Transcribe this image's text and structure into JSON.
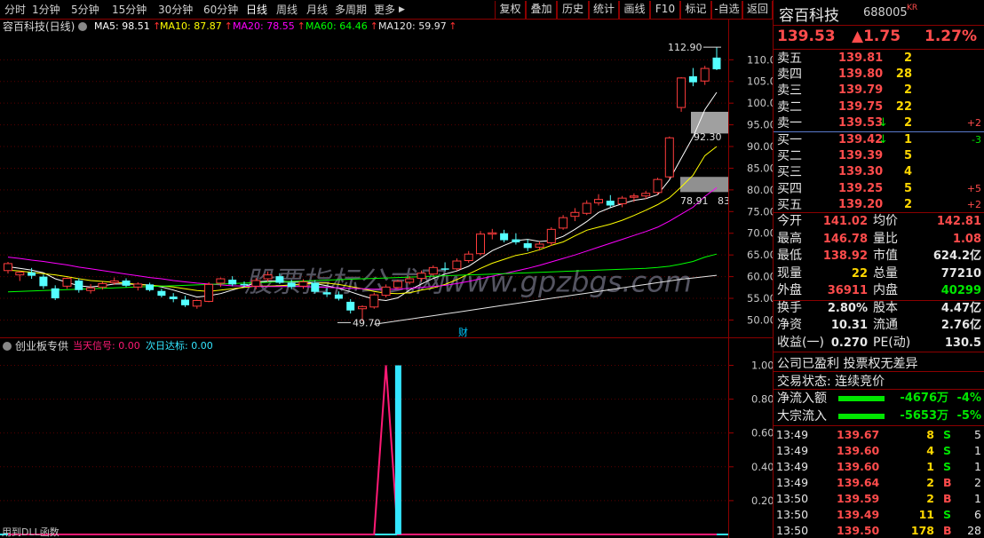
{
  "toolbar": {
    "periods": [
      "分时",
      "1分钟",
      "5分钟",
      "15分钟",
      "30分钟",
      "60分钟",
      "日线",
      "周线",
      "月线",
      "多周期",
      "更多"
    ],
    "active": "日线",
    "more_arrow": "▶",
    "buttons": [
      "复权",
      "叠加",
      "历史",
      "统计",
      "画线",
      "F10",
      "标记",
      "-自选",
      "返回"
    ]
  },
  "chart_title": "容百科技(日线)",
  "ma": [
    {
      "label": "MA5: 98.51",
      "color": "#ffffff"
    },
    {
      "label": "MA10: 87.87",
      "color": "#ffff00"
    },
    {
      "label": "MA20: 78.55",
      "color": "#ff00ff"
    },
    {
      "label": "MA60: 64.46",
      "color": "#00ff00"
    },
    {
      "label": "MA120: 59.97",
      "color": "#e6e6e6"
    }
  ],
  "ma_arrow": "↑",
  "indicator": {
    "name": "创业板专供",
    "signal_label": "当天信号: 0.00",
    "target_label": "次日达标: 0.00"
  },
  "watermark": "股票指标公式网www.gpzbgs.com",
  "fin_marker": "财",
  "bottom_note": "用到DLL函数",
  "chart_data": [
    {
      "type": "candlestick",
      "title": "容百科技(日线)",
      "ylim": [
        46,
        116
      ],
      "yticks": [
        "110.0",
        "105.0",
        "100.0",
        "95.00",
        "90.00",
        "85.00",
        "80.00",
        "75.00",
        "70.00",
        "65.00",
        "60.00",
        "55.00",
        "50.00"
      ],
      "annotations": {
        "high": "112.90",
        "mid": "92.30",
        "low": "49.70",
        "pre": "78.91",
        "pre_suffix": "83"
      },
      "candles": [
        [
          61.4,
          63.4,
          60.7,
          63.0
        ],
        [
          60.4,
          61.3,
          59.0,
          61.0
        ],
        [
          61.0,
          62.0,
          59.5,
          60.2
        ],
        [
          60.0,
          60.5,
          57.2,
          57.8
        ],
        [
          57.3,
          58.0,
          54.6,
          55.0
        ],
        [
          57.8,
          59.8,
          57.2,
          59.6
        ],
        [
          59.1,
          59.6,
          56.3,
          56.9
        ],
        [
          56.8,
          58.3,
          56.1,
          57.4
        ],
        [
          57.6,
          58.8,
          57.0,
          58.4
        ],
        [
          58.6,
          59.8,
          58.1,
          59.0
        ],
        [
          59.1,
          59.6,
          57.6,
          57.9
        ],
        [
          57.6,
          58.7,
          56.8,
          58.3
        ],
        [
          58.2,
          58.6,
          56.6,
          56.9
        ],
        [
          56.7,
          57.2,
          55.2,
          55.6
        ],
        [
          55.4,
          56.2,
          54.1,
          54.8
        ],
        [
          54.7,
          55.6,
          53.0,
          53.4
        ],
        [
          53.2,
          54.7,
          52.6,
          54.5
        ],
        [
          54.3,
          58.7,
          54.1,
          58.2
        ],
        [
          58.5,
          59.8,
          57.6,
          59.5
        ],
        [
          59.3,
          60.1,
          57.8,
          58.2
        ],
        [
          58.3,
          58.9,
          57.5,
          58.0
        ],
        [
          57.8,
          59.7,
          57.1,
          59.1
        ],
        [
          59.5,
          61.2,
          58.9,
          60.4
        ],
        [
          60.1,
          60.8,
          58.3,
          58.6
        ],
        [
          58.6,
          59.3,
          57.1,
          57.6
        ],
        [
          57.8,
          59.4,
          57.2,
          58.8
        ],
        [
          58.6,
          59.2,
          56.1,
          56.5
        ],
        [
          56.4,
          57.3,
          55.3,
          55.9
        ],
        [
          55.9,
          56.6,
          54.5,
          54.9
        ],
        [
          54.2,
          54.8,
          51.5,
          52.2
        ],
        [
          52.6,
          53.4,
          49.7,
          53.1
        ],
        [
          53.0,
          56.3,
          52.6,
          55.8
        ],
        [
          55.7,
          58.2,
          55.2,
          57.6
        ],
        [
          57.5,
          59.3,
          57.1,
          58.9
        ],
        [
          58.7,
          60.1,
          58.2,
          59.5
        ],
        [
          59.6,
          61.4,
          58.9,
          60.8
        ],
        [
          60.6,
          62.6,
          60.2,
          62.1
        ],
        [
          61.9,
          63.3,
          61.3,
          61.6
        ],
        [
          61.8,
          64.2,
          61.4,
          63.6
        ],
        [
          63.7,
          65.9,
          63.2,
          65.2
        ],
        [
          65.3,
          70.5,
          64.9,
          69.8
        ],
        [
          69.8,
          71.0,
          68.6,
          70.1
        ],
        [
          70.0,
          70.8,
          67.9,
          68.4
        ],
        [
          68.6,
          70.0,
          67.4,
          67.9
        ],
        [
          67.7,
          68.6,
          65.9,
          66.6
        ],
        [
          66.8,
          68.1,
          66.0,
          67.5
        ],
        [
          67.8,
          71.4,
          67.1,
          70.9
        ],
        [
          71.2,
          74.2,
          70.8,
          73.6
        ],
        [
          73.9,
          75.8,
          72.8,
          74.8
        ],
        [
          74.6,
          77.6,
          74.2,
          76.9
        ],
        [
          77.0,
          79.0,
          76.4,
          77.8
        ],
        [
          77.5,
          78.8,
          76.0,
          76.4
        ],
        [
          76.8,
          78.6,
          76.0,
          78.1
        ],
        [
          78.3,
          79.2,
          77.2,
          78.6
        ],
        [
          78.6,
          79.8,
          77.9,
          79.2
        ],
        [
          79.4,
          82.8,
          78.9,
          82.4
        ],
        [
          83.0,
          92.3,
          82.6,
          92.0
        ],
        [
          99.0,
          106.0,
          98.0,
          105.8
        ],
        [
          106.2,
          108.1,
          103.9,
          104.8
        ],
        [
          105.1,
          108.6,
          104.2,
          108.0
        ],
        [
          110.5,
          112.9,
          107.6,
          107.8
        ]
      ],
      "series": [
        {
          "name": "MA5",
          "color": "#ffffff",
          "values": [
            62.3,
            61.9,
            61.5,
            60.9,
            59.5,
            58.7,
            57.9,
            57.6,
            57.9,
            58.3,
            58.3,
            58.2,
            58.1,
            57.6,
            56.9,
            56.1,
            55.3,
            55.6,
            56.1,
            56.9,
            57.7,
            58.6,
            59.0,
            59.0,
            58.8,
            58.9,
            58.4,
            57.9,
            57.3,
            56.5,
            55.6,
            54.8,
            54.5,
            55.1,
            56.9,
            58.3,
            59.6,
            60.6,
            61.3,
            62.4,
            64.2,
            66.0,
            67.2,
            68.3,
            68.6,
            68.1,
            68.3,
            69.3,
            70.9,
            72.7,
            74.8,
            75.9,
            76.8,
            77.6,
            78.0,
            78.9,
            82.3,
            87.3,
            92.2,
            98.5,
            102.5
          ]
        },
        {
          "name": "MA10",
          "color": "#ffff00",
          "values": [
            61.5,
            61.3,
            61.0,
            60.7,
            60.4,
            60.0,
            59.5,
            59.1,
            58.9,
            58.7,
            58.5,
            58.2,
            58.0,
            57.8,
            57.6,
            57.2,
            56.8,
            56.6,
            56.9,
            57.2,
            57.5,
            57.8,
            57.8,
            57.9,
            58.1,
            58.3,
            58.5,
            58.5,
            58.2,
            57.7,
            57.2,
            56.6,
            56.2,
            56.1,
            56.3,
            56.9,
            57.4,
            58.2,
            59.3,
            60.6,
            61.9,
            63.1,
            64.0,
            64.9,
            65.4,
            66.2,
            67.2,
            68.0,
            69.4,
            70.7,
            71.4,
            72.1,
            73.0,
            74.1,
            75.3,
            76.6,
            78.2,
            80.7,
            83.4,
            87.9,
            90.0
          ]
        },
        {
          "name": "MA20",
          "color": "#ff00ff",
          "values": [
            64.5,
            64.2,
            63.8,
            63.5,
            63.1,
            62.7,
            62.2,
            61.8,
            61.4,
            61.0,
            60.6,
            60.2,
            59.8,
            59.5,
            59.1,
            58.8,
            58.5,
            58.3,
            58.1,
            57.9,
            57.8,
            57.7,
            57.7,
            57.7,
            57.7,
            57.7,
            57.6,
            57.5,
            57.4,
            57.3,
            57.2,
            57.1,
            57.1,
            57.1,
            57.3,
            57.5,
            57.7,
            58.0,
            58.4,
            58.9,
            59.5,
            60.1,
            60.7,
            61.3,
            61.9,
            62.6,
            63.4,
            64.2,
            65.0,
            65.9,
            66.8,
            67.7,
            68.6,
            69.5,
            70.4,
            71.4,
            72.8,
            74.4,
            76.0,
            78.5,
            80.5
          ]
        },
        {
          "name": "MA60",
          "color": "#00ff00",
          "values": [
            56.5,
            56.6,
            56.7,
            56.8,
            56.9,
            57.0,
            57.1,
            57.2,
            57.3,
            57.4,
            57.5,
            57.6,
            57.7,
            57.8,
            57.9,
            58.0,
            58.1,
            58.2,
            58.3,
            58.4,
            58.5,
            58.6,
            58.7,
            58.8,
            58.9,
            59.0,
            59.1,
            59.2,
            59.3,
            59.4,
            59.5,
            59.6,
            59.7,
            59.8,
            59.9,
            60.0,
            60.1,
            60.2,
            60.3,
            60.4,
            60.5,
            60.6,
            60.7,
            60.8,
            60.9,
            61.0,
            61.1,
            61.2,
            61.3,
            61.4,
            61.5,
            61.6,
            61.7,
            61.8,
            61.9,
            62.1,
            62.4,
            62.9,
            63.5,
            64.5,
            65.2
          ]
        },
        {
          "name": "MA120",
          "color": "#e6e6e6",
          "values": [
            null,
            null,
            null,
            null,
            null,
            null,
            null,
            null,
            null,
            null,
            null,
            null,
            null,
            null,
            null,
            null,
            null,
            null,
            null,
            null,
            null,
            null,
            null,
            null,
            null,
            null,
            null,
            null,
            null,
            null,
            null,
            49.0,
            49.4,
            49.8,
            50.2,
            50.6,
            51.0,
            51.4,
            51.8,
            52.2,
            52.6,
            53.0,
            53.4,
            53.8,
            54.2,
            54.6,
            55.0,
            55.4,
            55.8,
            56.2,
            56.6,
            57.0,
            57.4,
            57.8,
            58.2,
            58.6,
            59.0,
            59.4,
            59.7,
            60.0,
            60.3
          ]
        }
      ]
    },
    {
      "type": "line",
      "title": "创业板专供",
      "ylim": [
        0,
        1.05
      ],
      "yticks": [
        "1.00",
        "0.80",
        "0.60",
        "0.40",
        "0.20"
      ],
      "series": [
        {
          "name": "当天信号",
          "color": "#ff1a75",
          "values": [
            0,
            0,
            0,
            0,
            0,
            0,
            0,
            0,
            0,
            0,
            0,
            0,
            0,
            0,
            0,
            0,
            0,
            0,
            0,
            0,
            0,
            0,
            0,
            0,
            0,
            0,
            0,
            0,
            0,
            0,
            0,
            0,
            1,
            0,
            0,
            0,
            0,
            0,
            0,
            0,
            0,
            0,
            0,
            0,
            0,
            0,
            0,
            0,
            0,
            0,
            0,
            0,
            0,
            0,
            0,
            0,
            0,
            0,
            0,
            0,
            0
          ]
        },
        {
          "name": "次日达标",
          "color": "#33e6ff",
          "values": [
            0,
            0,
            0,
            0,
            0,
            0,
            0,
            0,
            0,
            0,
            0,
            0,
            0,
            0,
            0,
            0,
            0,
            0,
            0,
            0,
            0,
            0,
            0,
            0,
            0,
            0,
            0,
            0,
            0,
            0,
            0,
            0,
            0,
            1,
            0,
            0,
            0,
            0,
            0,
            0,
            0,
            0,
            0,
            0,
            0,
            0,
            0,
            0,
            0,
            0,
            0,
            0,
            0,
            0,
            0,
            0,
            0,
            0,
            0,
            0,
            0
          ]
        }
      ]
    }
  ],
  "quote": {
    "name": "容百科技",
    "code": "688005",
    "tag": "KR",
    "price": "139.53",
    "change": "▲1.75",
    "pct": "1.27%",
    "asks": [
      {
        "label": "卖五",
        "price": "139.81",
        "vol": "2",
        "arrow": "",
        "delta": ""
      },
      {
        "label": "卖四",
        "price": "139.80",
        "vol": "28",
        "arrow": "",
        "delta": ""
      },
      {
        "label": "卖三",
        "price": "139.79",
        "vol": "2",
        "arrow": "",
        "delta": ""
      },
      {
        "label": "卖二",
        "price": "139.75",
        "vol": "22",
        "arrow": "",
        "delta": ""
      },
      {
        "label": "卖一",
        "price": "139.53",
        "vol": "2",
        "arrow": "↓",
        "delta": "+2"
      }
    ],
    "bids": [
      {
        "label": "买一",
        "price": "139.42",
        "vol": "1",
        "arrow": "↓",
        "delta": "-3"
      },
      {
        "label": "买二",
        "price": "139.39",
        "vol": "5",
        "arrow": "",
        "delta": ""
      },
      {
        "label": "买三",
        "price": "139.30",
        "vol": "4",
        "arrow": "",
        "delta": ""
      },
      {
        "label": "买四",
        "price": "139.25",
        "vol": "5",
        "arrow": "",
        "delta": "+5"
      },
      {
        "label": "买五",
        "price": "139.20",
        "vol": "2",
        "arrow": "",
        "delta": "+2"
      }
    ],
    "stats": [
      {
        "l1": "今开",
        "v1": "141.02",
        "l2": "均价",
        "v2": "142.81"
      },
      {
        "l1": "最高",
        "v1": "146.78",
        "l2": "量比",
        "v2": "1.08"
      },
      {
        "l1": "最低",
        "v1": "138.92",
        "l2": "市值",
        "v2": "624.2亿"
      },
      {
        "l1": "现量",
        "v1": "22",
        "l2": "总量",
        "v2": "77210"
      },
      {
        "l1": "外盘",
        "v1": "36911",
        "l2": "内盘",
        "v2": "40299"
      }
    ],
    "stats2": [
      {
        "l1": "换手",
        "v1": "2.80%",
        "l2": "股本",
        "v2": "4.47亿"
      },
      {
        "l1": "净资",
        "v1": "10.31",
        "l2": "流通",
        "v2": "2.76亿"
      },
      {
        "l1": "收益(一)",
        "v1": "0.270",
        "l2": "PE(动)",
        "v2": "130.5"
      }
    ],
    "notice": "公司已盈利 投票权无差异",
    "trade_status": "交易状态: 连续竞价",
    "flows": [
      {
        "label": "净流入额",
        "value": "-4676万",
        "pct": "-4%",
        "bar": 0.92
      },
      {
        "label": "大宗流入",
        "value": "-5653万",
        "pct": "-5%",
        "bar": 0.92
      }
    ],
    "ticks": [
      {
        "time": "13:49",
        "price": "139.67",
        "vol": "8",
        "side": "S",
        "count": "5"
      },
      {
        "time": "13:49",
        "price": "139.60",
        "vol": "4",
        "side": "S",
        "count": "1"
      },
      {
        "time": "13:49",
        "price": "139.60",
        "vol": "1",
        "side": "S",
        "count": "1"
      },
      {
        "time": "13:49",
        "price": "139.64",
        "vol": "2",
        "side": "B",
        "count": "2"
      },
      {
        "time": "13:50",
        "price": "139.59",
        "vol": "2",
        "side": "B",
        "count": "1"
      },
      {
        "time": "13:50",
        "price": "139.49",
        "vol": "11",
        "side": "S",
        "count": "6"
      },
      {
        "time": "13:50",
        "price": "139.50",
        "vol": "178",
        "side": "B",
        "count": "28"
      }
    ]
  }
}
